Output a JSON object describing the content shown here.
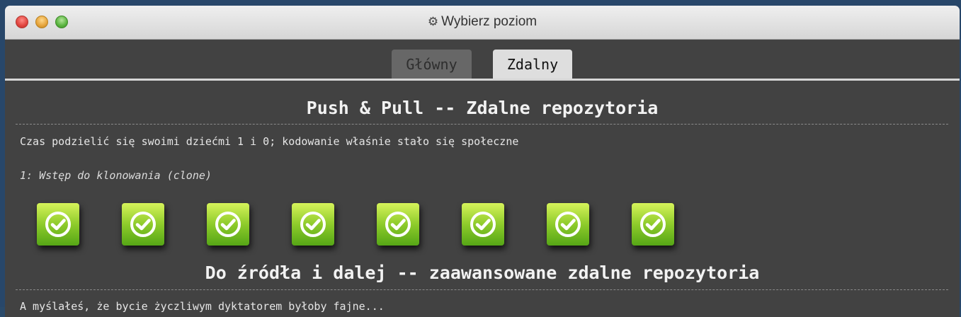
{
  "window": {
    "title": "Wybierz poziom",
    "title_icon": "gear-icon"
  },
  "tabs": [
    {
      "label": "Główny",
      "active": false
    },
    {
      "label": "Zdalny",
      "active": true
    }
  ],
  "sections": [
    {
      "title": "Push & Pull -- Zdalne repozytoria",
      "description": "Czas podzielić się swoimi dziećmi 1 i 0; kodowanie właśnie stało się społeczne",
      "sequence_name": "1: Wstęp do klonowania (clone)",
      "levels": [
        {
          "status": "completed",
          "icon": "check-icon"
        },
        {
          "status": "completed",
          "icon": "check-icon"
        },
        {
          "status": "completed",
          "icon": "check-icon"
        },
        {
          "status": "completed",
          "icon": "check-icon"
        },
        {
          "status": "completed",
          "icon": "check-icon"
        },
        {
          "status": "completed",
          "icon": "check-icon"
        },
        {
          "status": "completed",
          "icon": "check-icon"
        },
        {
          "status": "completed",
          "icon": "check-icon"
        }
      ]
    },
    {
      "title": "Do źródła i dalej -- zaawansowane zdalne repozytoria",
      "description": "A myślałeś, że bycie życzliwym dyktatorem byłoby fajne..."
    }
  ],
  "colors": {
    "window_bg": "#424242",
    "level_complete_top": "#d6f35a",
    "level_complete_bottom": "#55a616",
    "tab_active_bg": "#dedede",
    "tab_inactive_bg": "#676767"
  }
}
